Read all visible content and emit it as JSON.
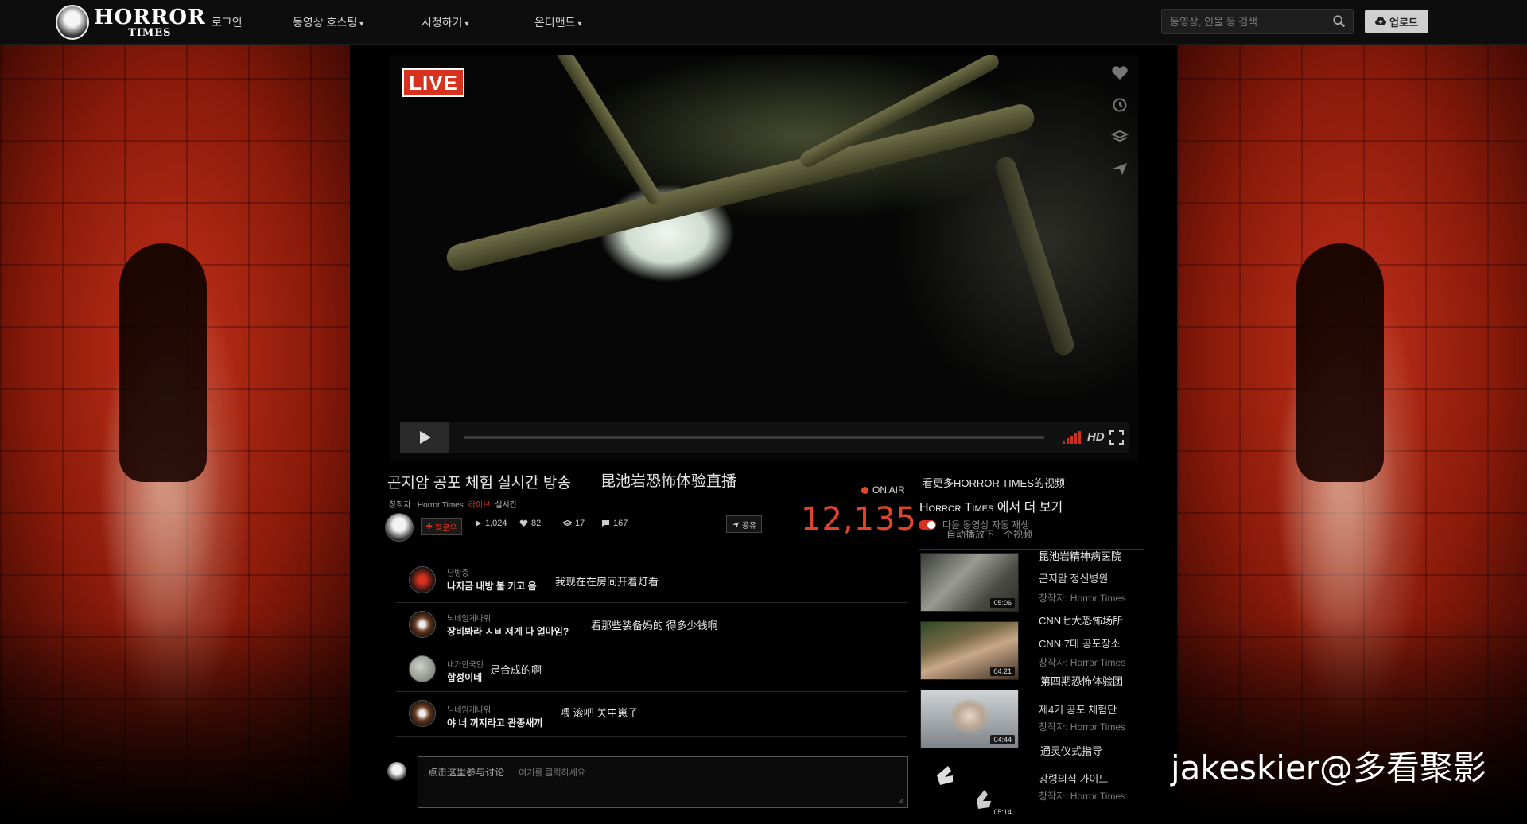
{
  "header": {
    "logo_top": "HORROR",
    "logo_bottom": "TIMES",
    "nav": [
      {
        "label": "로그인",
        "caret": false
      },
      {
        "label": "동영상 호스팅",
        "caret": true
      },
      {
        "label": "시청하기",
        "caret": true
      },
      {
        "label": "온디맨드",
        "caret": true
      }
    ],
    "search_placeholder": "동영상, 인물 등 검색",
    "upload_label": "업로드"
  },
  "player": {
    "live_label": "LIVE",
    "quality_label": "HD",
    "side_icons": [
      "heart-icon",
      "clock-icon",
      "layers-icon",
      "send-icon"
    ],
    "progress": 0.0
  },
  "video": {
    "title_ko": "곤지암 공포 체험 실시간 방송",
    "title_zh": "昆池岩恐怖体验直播",
    "author_prefix": "창작자 : Horror Times",
    "live_tag": "라이브",
    "realtime_tag": "실시간",
    "follow_label": "팔로우",
    "stats": {
      "plays": "1,024",
      "likes": "82",
      "layers": "17",
      "comments": "167"
    },
    "share_label": "공유",
    "on_air_label": "ON AIR",
    "viewer_count": "12,135"
  },
  "chat": [
    {
      "user": "난방중",
      "message": "나지금 내방 불 키고 옴",
      "translation": "我现在在房间开着灯看"
    },
    {
      "user": "닉네임게나워",
      "message": "장비봐라 ㅅㅂ 저게 다 얼마임?",
      "translation": "看那些装备妈的 得多少钱啊"
    },
    {
      "user": "내가한국인",
      "message": "합성이네",
      "translation": "是合成的啊"
    },
    {
      "user": "닉네임게나워",
      "message": "야 너 꺼지라고 관종새끼",
      "translation": "喂 滚吧 关中崽子"
    }
  ],
  "compose": {
    "zh_hint": "点击这里参与讨论",
    "ko_placeholder": "여기를 클릭하세요"
  },
  "sidebar": {
    "more_zh": "看更多HORROR TIMES的视频",
    "more_en": "Horror Times 에서 더 보기",
    "autoplay_ko": "다음 동영상 자동 재생",
    "autoplay_zh": "自动播放下一个视频",
    "autoplay_on": true,
    "recommendations": [
      {
        "zh": "昆池岩精神病医院",
        "ko": "곤지암 정신병원",
        "author": "창작자: Horror Times",
        "duration": "05:06"
      },
      {
        "zh": "CNN七大恐怖场所",
        "ko": "CNN 7대 공포장소",
        "author": "창작자: Horror Times",
        "duration": "04:21"
      },
      {
        "zh": "第四期恐怖体验团",
        "ko": "제4기 공포 체험단",
        "author": "창작자: Horror Times",
        "duration": "04:44"
      },
      {
        "zh": "通灵仪式指导",
        "ko": "강령의식 가이드",
        "author": "창작자: Horror Times",
        "duration": "05:14"
      }
    ]
  },
  "watermark": "jakeskier@多看聚影",
  "colors": {
    "accent": "#d8321f",
    "viewer_count": "#e0452b",
    "background": "#000000"
  }
}
